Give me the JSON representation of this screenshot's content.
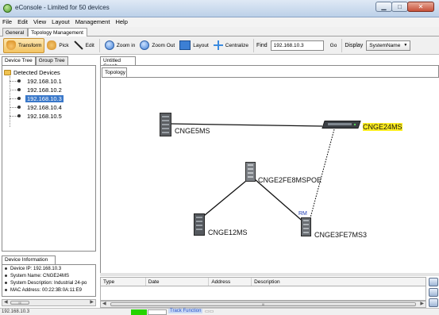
{
  "window": {
    "title": "eConsole - Limited for 50 devices",
    "minimize": "▁",
    "maximize": "□",
    "close": "✕"
  },
  "menu": [
    "File",
    "Edit",
    "View",
    "Layout",
    "Management",
    "Help"
  ],
  "top_tabs": [
    "General",
    "Topology Management"
  ],
  "toolbar": {
    "transform": "Transform",
    "pick": "Pick",
    "edit": "Edit",
    "zoom_in": "Zoom in",
    "zoom_out": "Zoom Out",
    "layout": "Layout",
    "centralize": "Centralize",
    "find_label": "Find",
    "find_value": "192.168.10.3",
    "go": "Go",
    "display_label": "Display",
    "display_value": "SystemName"
  },
  "left_tabs": [
    "Device Tree",
    "Group Tree"
  ],
  "tree": {
    "root": "Detected Devices",
    "items": [
      "192.168.10.1",
      "192.168.10.2",
      "192.168.10.3",
      "192.168.10.4",
      "192.168.10.5"
    ],
    "selected_index": 2
  },
  "device_info": {
    "tab": "Device Information",
    "lines": [
      "Device IP: 192.168.10.3",
      "System Name: CNGE24MS",
      "System Description: Industrial 24-po",
      "MAC Address: 00:22:3B:0A:11:E9"
    ]
  },
  "graph": {
    "tab": "Untitled Graph",
    "subtab": "Topology",
    "nodes": {
      "cnge5ms": "CNGE5MS",
      "cnge24ms": "CNGE24MS",
      "cnge2fe8mspoe": "CNGE2FE8MSPOE",
      "cnge12ms": "CNGE12MS",
      "cnge3fe7ms3": "CNGE3FE7MS3"
    },
    "rm_label": "RM"
  },
  "log": {
    "columns": [
      "Type",
      "Date",
      "Address",
      "Description"
    ]
  },
  "status": {
    "ip": "192.168.10.3",
    "track": "Track Function"
  },
  "colors": {
    "selection": "#3a78c9",
    "highlight": "#ffee22",
    "status_green": "#27d400"
  }
}
